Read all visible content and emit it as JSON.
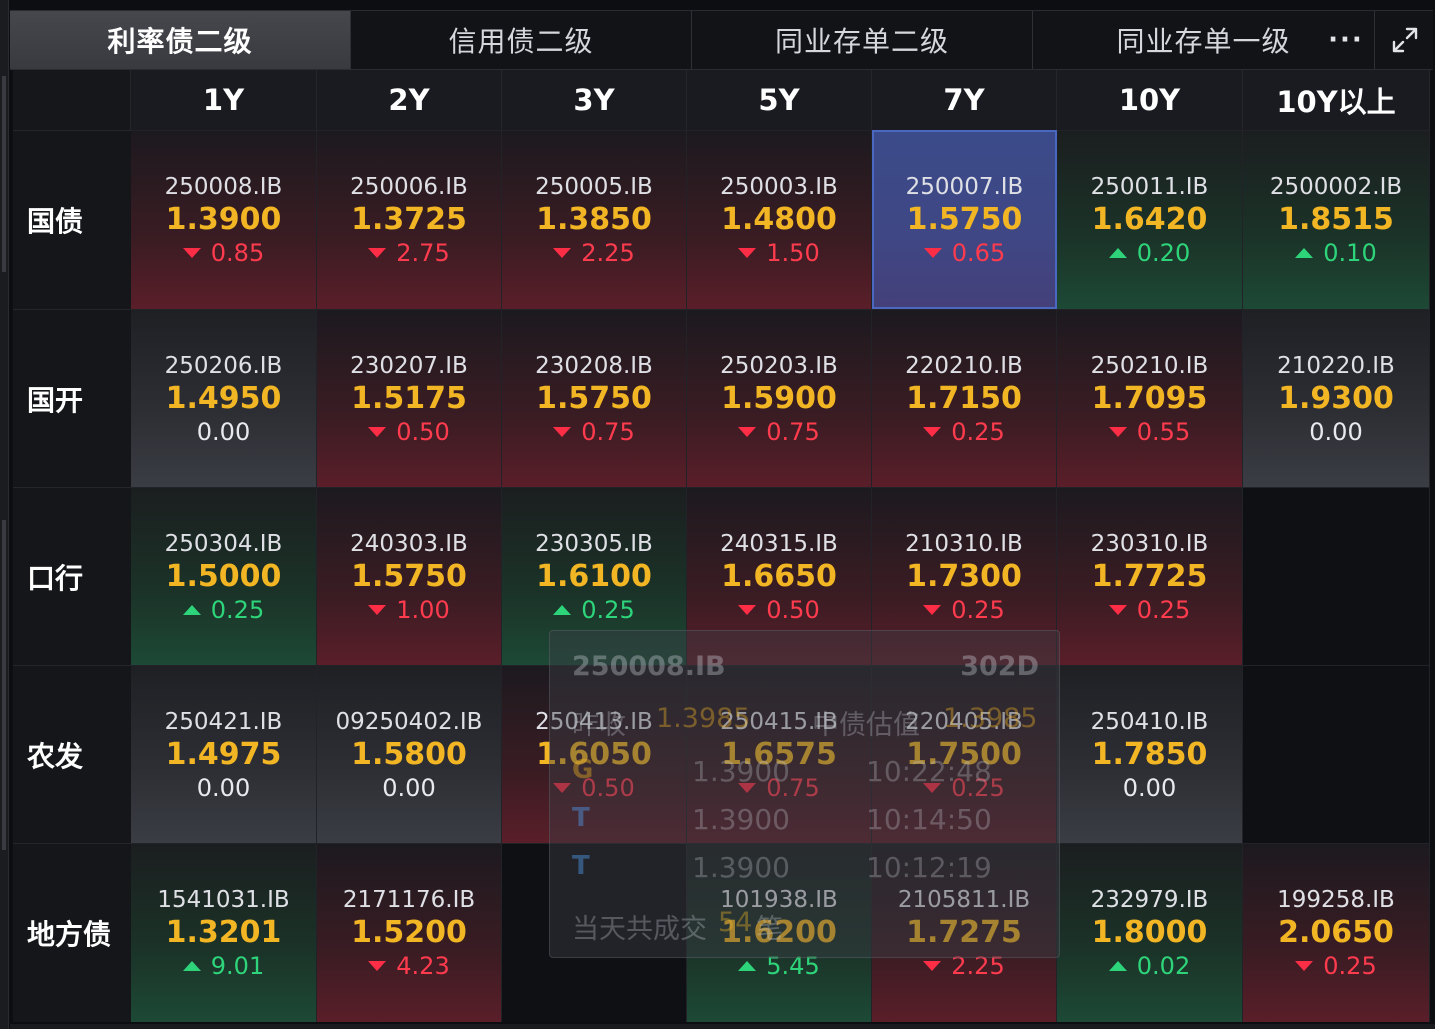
{
  "tabs": [
    {
      "label": "利率债二级",
      "active": true
    },
    {
      "label": "信用债二级",
      "active": false
    },
    {
      "label": "同业存单二级",
      "active": false
    },
    {
      "label": "同业存单一级",
      "active": false
    }
  ],
  "more_icon": "ellipsis-icon",
  "expand_icon": "expand-diagonal-icon",
  "columns": [
    "1Y",
    "2Y",
    "3Y",
    "5Y",
    "7Y",
    "10Y",
    "10Y以上"
  ],
  "rows": [
    {
      "label": "国债",
      "cells": [
        {
          "code": "250008.IB",
          "rate": "1.3900",
          "change": "0.85",
          "dir": "down"
        },
        {
          "code": "250006.IB",
          "rate": "1.3725",
          "change": "2.75",
          "dir": "down"
        },
        {
          "code": "250005.IB",
          "rate": "1.3850",
          "change": "2.25",
          "dir": "down"
        },
        {
          "code": "250003.IB",
          "rate": "1.4800",
          "change": "1.50",
          "dir": "down"
        },
        {
          "code": "250007.IB",
          "rate": "1.5750",
          "change": "0.65",
          "dir": "down",
          "selected": true
        },
        {
          "code": "250011.IB",
          "rate": "1.6420",
          "change": "0.20",
          "dir": "up"
        },
        {
          "code": "2500002.IB",
          "rate": "1.8515",
          "change": "0.10",
          "dir": "up"
        }
      ]
    },
    {
      "label": "国开",
      "cells": [
        {
          "code": "250206.IB",
          "rate": "1.4950",
          "change": "0.00",
          "dir": "flat"
        },
        {
          "code": "230207.IB",
          "rate": "1.5175",
          "change": "0.50",
          "dir": "down"
        },
        {
          "code": "230208.IB",
          "rate": "1.5750",
          "change": "0.75",
          "dir": "down"
        },
        {
          "code": "250203.IB",
          "rate": "1.5900",
          "change": "0.75",
          "dir": "down"
        },
        {
          "code": "220210.IB",
          "rate": "1.7150",
          "change": "0.25",
          "dir": "down"
        },
        {
          "code": "250210.IB",
          "rate": "1.7095",
          "change": "0.55",
          "dir": "down"
        },
        {
          "code": "210220.IB",
          "rate": "1.9300",
          "change": "0.00",
          "dir": "flat"
        }
      ]
    },
    {
      "label": "口行",
      "cells": [
        {
          "code": "250304.IB",
          "rate": "1.5000",
          "change": "0.25",
          "dir": "up"
        },
        {
          "code": "240303.IB",
          "rate": "1.5750",
          "change": "1.00",
          "dir": "down"
        },
        {
          "code": "230305.IB",
          "rate": "1.6100",
          "change": "0.25",
          "dir": "up"
        },
        {
          "code": "240315.IB",
          "rate": "1.6650",
          "change": "0.50",
          "dir": "down"
        },
        {
          "code": "210310.IB",
          "rate": "1.7300",
          "change": "0.25",
          "dir": "down"
        },
        {
          "code": "230310.IB",
          "rate": "1.7725",
          "change": "0.25",
          "dir": "down"
        },
        null
      ]
    },
    {
      "label": "农发",
      "cells": [
        {
          "code": "250421.IB",
          "rate": "1.4975",
          "change": "0.00",
          "dir": "flat"
        },
        {
          "code": "09250402.IB",
          "rate": "1.5800",
          "change": "0.00",
          "dir": "flat"
        },
        {
          "code": "250413.IB",
          "rate": "1.6050",
          "change": "0.50",
          "dir": "down"
        },
        {
          "code": "250415.IB",
          "rate": "1.6575",
          "change": "0.75",
          "dir": "down"
        },
        {
          "code": "220405.IB",
          "rate": "1.7500",
          "change": "0.25",
          "dir": "down"
        },
        {
          "code": "250410.IB",
          "rate": "1.7850",
          "change": "0.00",
          "dir": "flat"
        },
        null
      ]
    },
    {
      "label": "地方债",
      "cells": [
        {
          "code": "1541031.IB",
          "rate": "1.3201",
          "change": "9.01",
          "dir": "up"
        },
        {
          "code": "2171176.IB",
          "rate": "1.5200",
          "change": "4.23",
          "dir": "down"
        },
        null,
        {
          "code": "101938.IB",
          "rate": "1.6200",
          "change": "5.45",
          "dir": "up"
        },
        {
          "code": "2105811.IB",
          "rate": "1.7275",
          "change": "2.25",
          "dir": "down"
        },
        {
          "code": "232979.IB",
          "rate": "1.8000",
          "change": "0.02",
          "dir": "up"
        },
        {
          "code": "199258.IB",
          "rate": "2.0650",
          "change": "0.25",
          "dir": "down"
        }
      ]
    }
  ],
  "tooltip": {
    "code": "250008.IB",
    "days": "302D",
    "prev_close_label": "昨收",
    "prev_close": "1.3985",
    "valuation_label": "中债估值",
    "valuation": "1.3985",
    "trades": [
      {
        "tag": "G",
        "price": "1.3900",
        "time": "10:22:48"
      },
      {
        "tag": "T",
        "price": "1.3900",
        "time": "10:14:50"
      },
      {
        "tag": "T",
        "price": "1.3900",
        "time": "10:12:19"
      }
    ],
    "summary_prefix": "当天共成交",
    "summary_count": "54",
    "summary_suffix": "笔"
  },
  "colors": {
    "rate": "#f2b524",
    "down": "#ff3b4e",
    "up": "#2ed47a",
    "selected_border": "#4a68c2"
  }
}
